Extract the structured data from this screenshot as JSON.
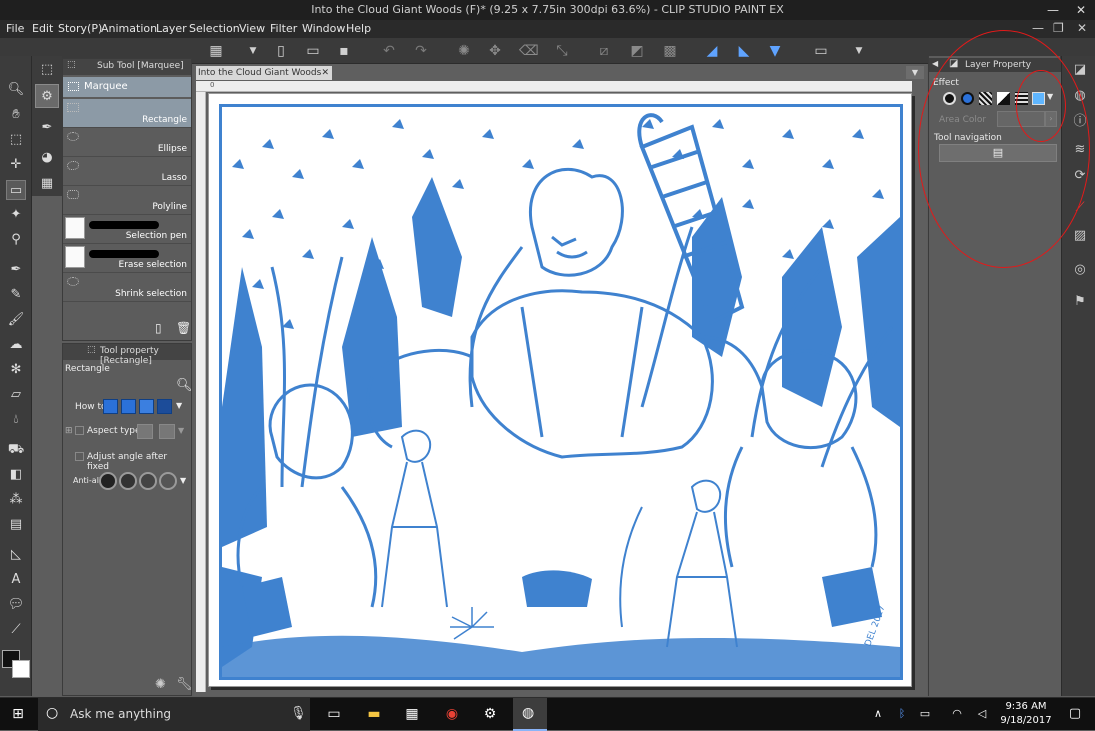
{
  "window": {
    "title": "Into the Cloud Giant Woods (F)* (9.25 x 7.75in 300dpi 63.6%)  - CLIP STUDIO PAINT EX",
    "minimize": "—",
    "restore": "❐",
    "close": "✕"
  },
  "menu": {
    "items": [
      "File",
      "Edit",
      "Story(P)",
      "Animation",
      "Layer",
      "Selection",
      "View",
      "Filter",
      "Window",
      "Help"
    ],
    "controls": {
      "minimize": "—",
      "restore": "❐",
      "close": "✕"
    }
  },
  "sub_tool_panel": {
    "tab_label": "Sub Tool [Marquee]",
    "group_label": "Marquee",
    "items": [
      "Rectangle",
      "Ellipse",
      "Lasso",
      "Polyline",
      "Selection pen",
      "Erase selection",
      "Shrink selection"
    ]
  },
  "tool_property_panel": {
    "tab_label": "Tool property [Rectangle]",
    "tool_name": "Rectangle",
    "how_to_label": "How to",
    "aspect_type_label": "Aspect type",
    "adjust_angle_label": "Adjust angle after fixed",
    "anti_alias_label": "Anti-ali"
  },
  "canvas": {
    "tab_label": "Into the Cloud Giant Woods (F)*",
    "tab_close": "✕",
    "ruler_start": "0",
    "line_color": "#3f82cf",
    "signature": "DEL 2017"
  },
  "layer_property_panel": {
    "tab_label": "Layer Property",
    "effect_label": "Effect",
    "area_color_label": "Area Color",
    "tool_navigation_label": "Tool navigation"
  },
  "annotation": {
    "color": "#e21a1a"
  },
  "taskbar": {
    "search_placeholder": "Ask me anything",
    "time": "9:36 AM",
    "date": "9/18/2017"
  }
}
